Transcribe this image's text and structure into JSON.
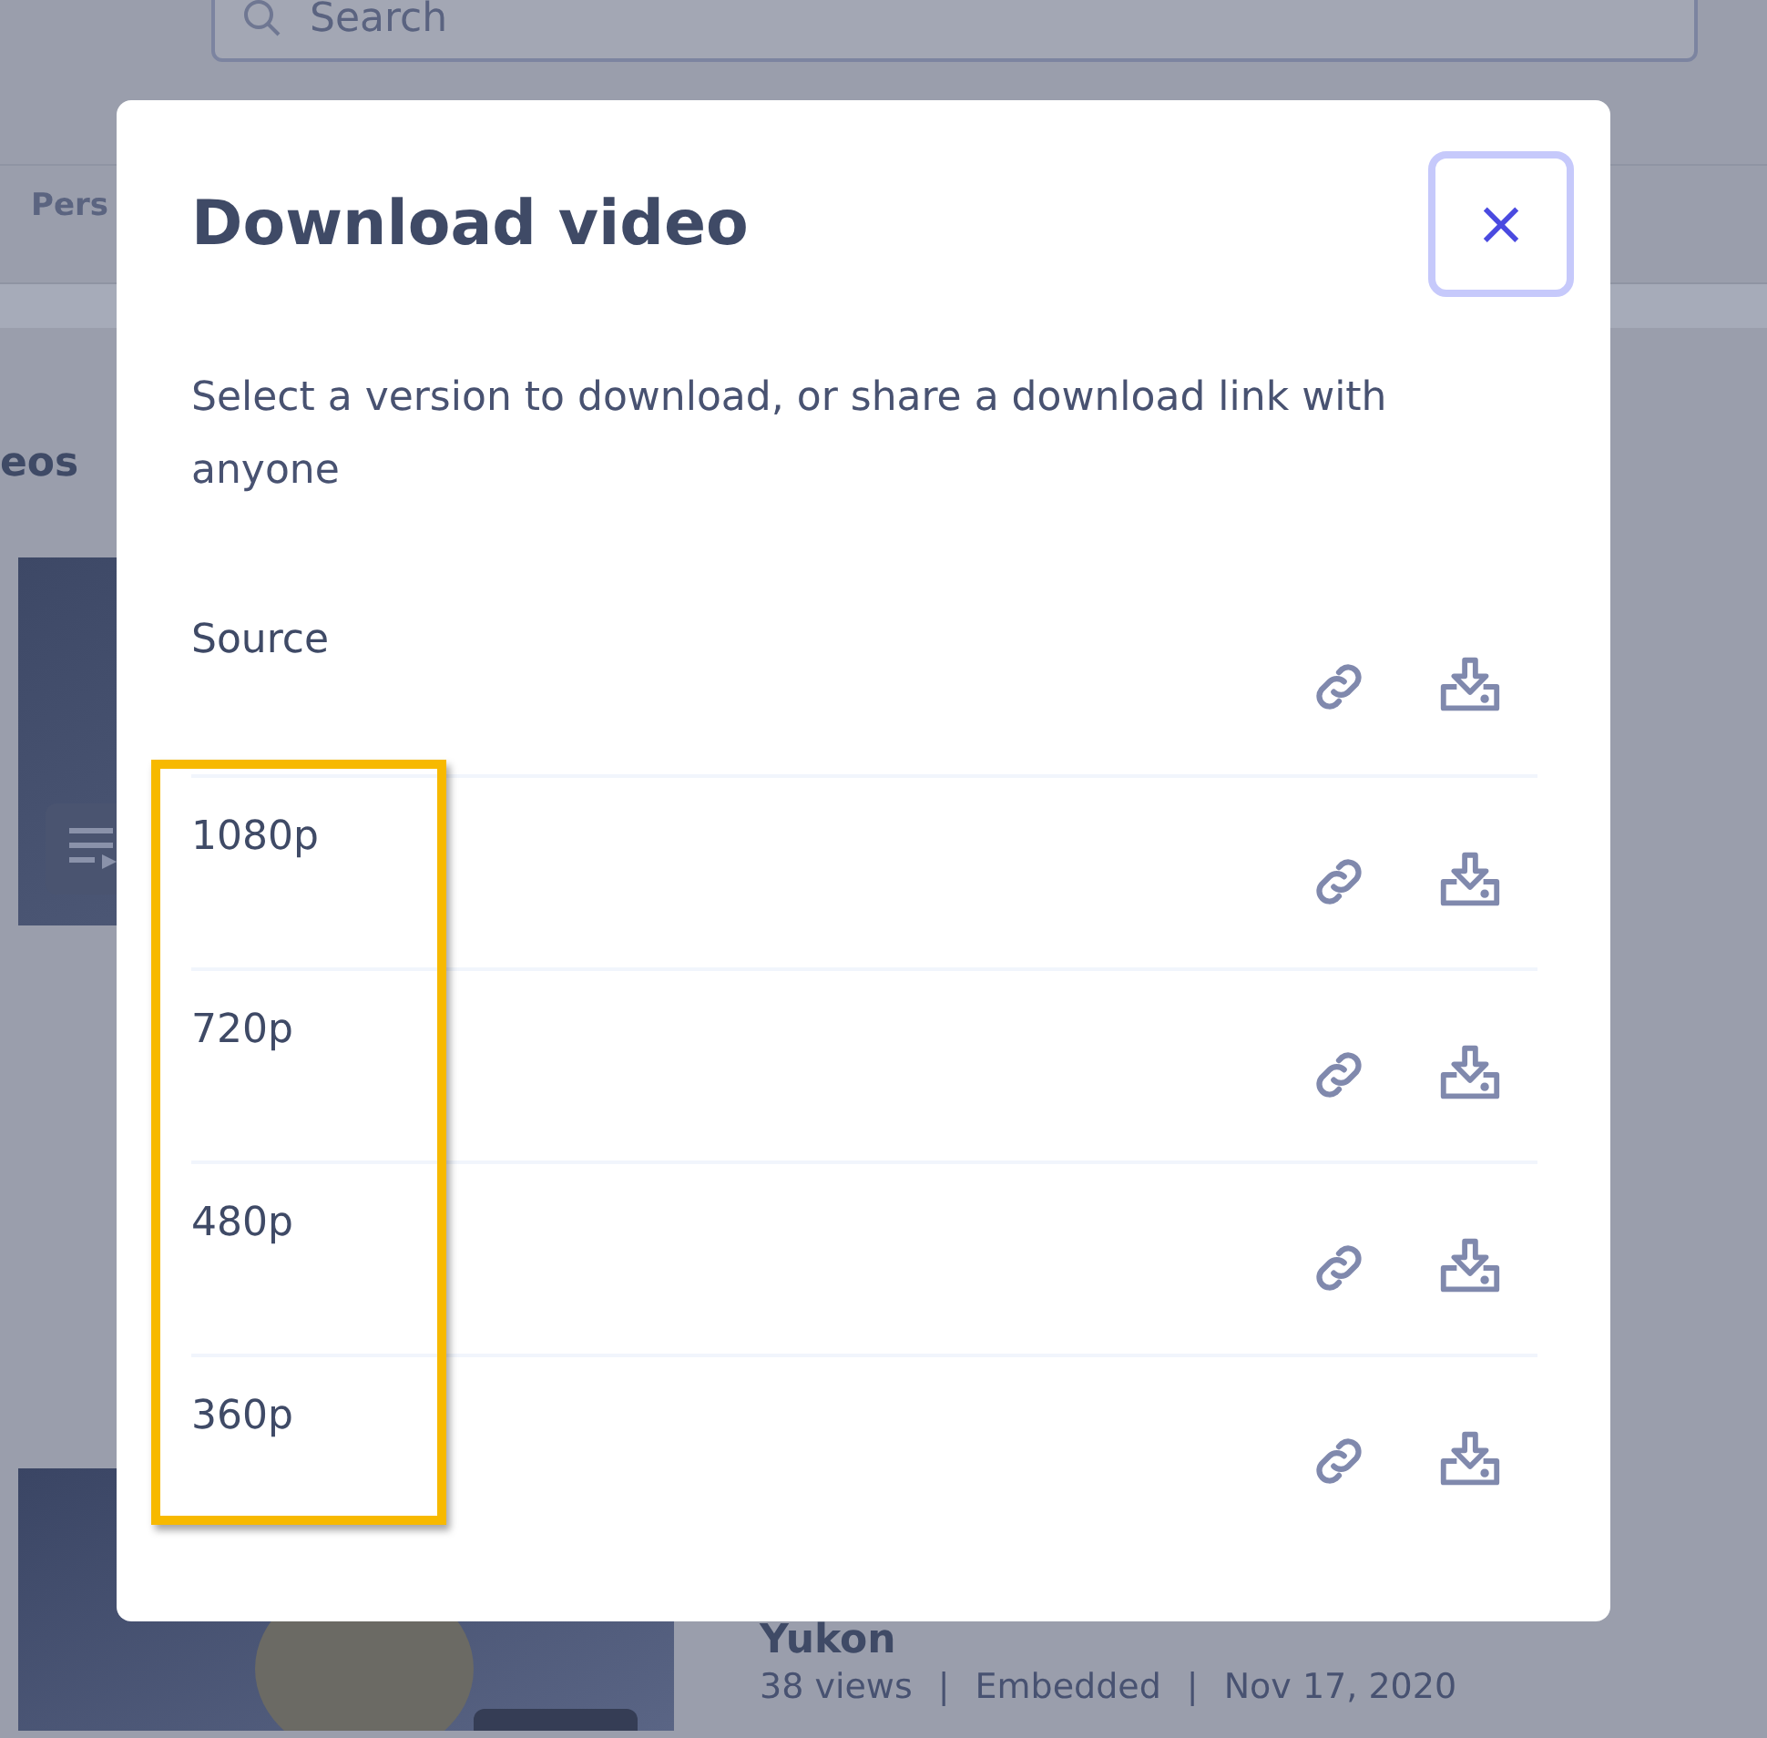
{
  "page": {
    "search": {
      "placeholder": "Search"
    },
    "tab": "Pers",
    "section_title": "eos",
    "videos": [
      {
        "kind": "playlist"
      },
      {
        "kind": "picture",
        "title": "Yukon",
        "meta": [
          "38 views",
          "|",
          "Embedded",
          "|",
          "Nov 17, 2020"
        ]
      }
    ]
  },
  "dialog": {
    "title": "Download video",
    "close": "×",
    "description": "Select a version to download, or share a download link with anyone",
    "versions": [
      {
        "label": "Source",
        "highlighted": false
      },
      {
        "label": "1080p",
        "highlighted": true
      },
      {
        "label": "720p",
        "highlighted": true
      },
      {
        "label": "480p",
        "highlighted": true
      },
      {
        "label": "360p",
        "highlighted": true
      }
    ]
  }
}
